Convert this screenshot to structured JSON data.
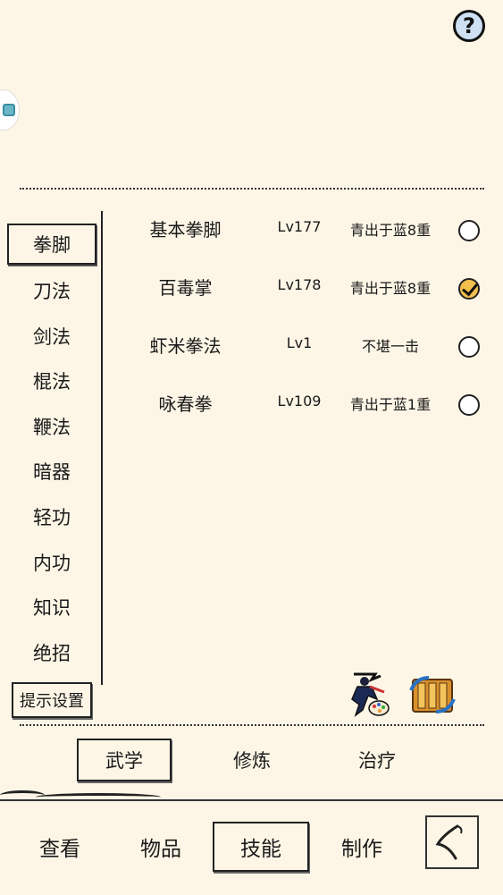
{
  "header": {
    "help_label": "?"
  },
  "categories": [
    {
      "label": "拳脚",
      "active": true
    },
    {
      "label": "刀法",
      "active": false
    },
    {
      "label": "剑法",
      "active": false
    },
    {
      "label": "棍法",
      "active": false
    },
    {
      "label": "鞭法",
      "active": false
    },
    {
      "label": "暗器",
      "active": false
    },
    {
      "label": "轻功",
      "active": false
    },
    {
      "label": "内功",
      "active": false
    },
    {
      "label": "知识",
      "active": false
    },
    {
      "label": "绝招",
      "active": false
    }
  ],
  "skills": [
    {
      "name": "基本拳脚",
      "level": "Lv177",
      "tier": "青出于蓝8重",
      "selected": false
    },
    {
      "name": "百毒掌",
      "level": "Lv178",
      "tier": "青出于蓝8重",
      "selected": true
    },
    {
      "name": "虾米拳法",
      "level": "Lv1",
      "tier": "不堪一击",
      "selected": false
    },
    {
      "name": "咏春拳",
      "level": "Lv109",
      "tier": "青出于蓝1重",
      "selected": false
    }
  ],
  "hint_settings_label": "提示设置",
  "subtabs": [
    {
      "label": "武学",
      "active": true
    },
    {
      "label": "修炼",
      "active": false
    },
    {
      "label": "治疗",
      "active": false
    }
  ],
  "nav": [
    {
      "label": "查看",
      "active": false
    },
    {
      "label": "物品",
      "active": false
    },
    {
      "label": "技能",
      "active": true
    },
    {
      "label": "制作",
      "active": false
    }
  ],
  "icons": {
    "help": "question-mark-icon",
    "art": "swordsman-palette-icon",
    "scroll": "skill-scroll-icon",
    "back": "back-arrow-icon"
  },
  "colors": {
    "background": "#fdf6e6",
    "ink": "#1a1a1a",
    "help_fill": "#cfe0f3",
    "check_fill": "#f2c04e"
  }
}
